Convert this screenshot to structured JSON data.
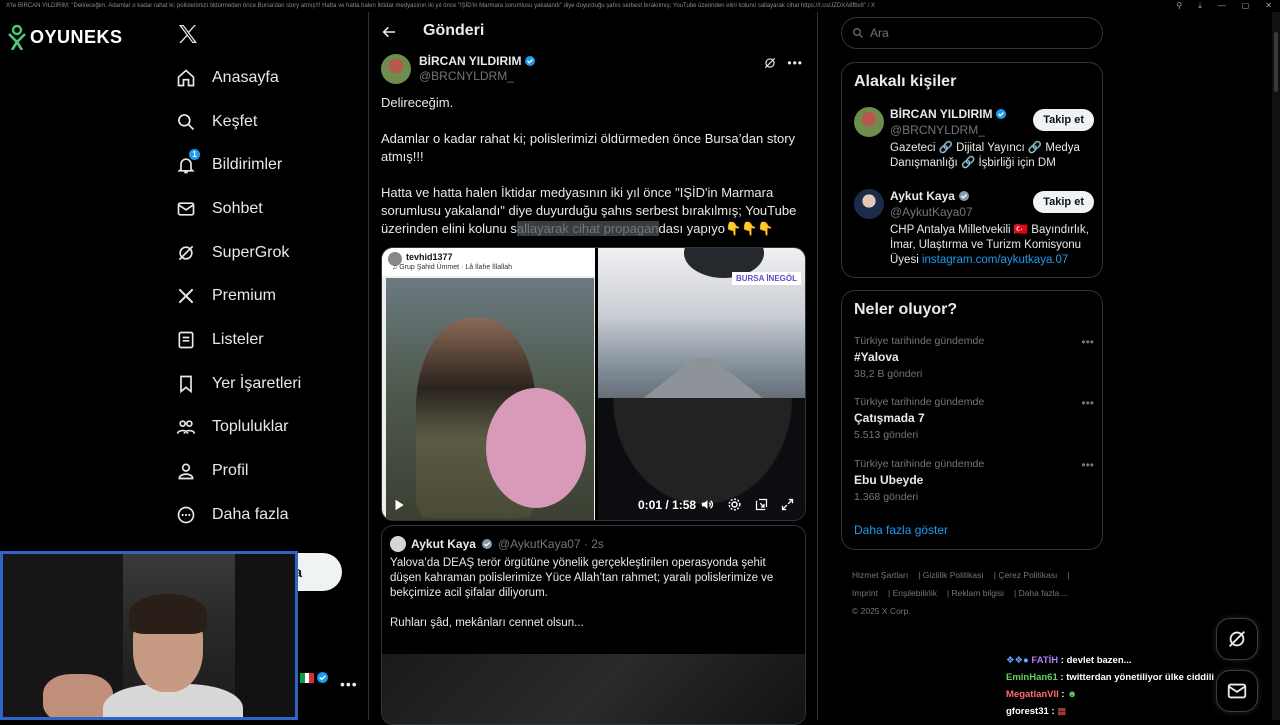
{
  "window": {
    "title": "X'te BİRCAN YILDIRIM: \"Delireceğim. Adamlar o kadar rahat ki; polislerimizi öldürmeden önce Bursa'dan story atmış!!! Hatta ve hatta halen İktidar medyasının iki yıl önce \"IŞİD'in Marmara sorumlusu yakalandı\" diye duyurduğu şahıs serbest bırakılmış; YouTube üzerinden elini kolunu sallayarak cihat https://t.co/JZDXA8fbv8\" / X"
  },
  "brand": {
    "name": "OYUNEKS"
  },
  "nav": {
    "items": [
      {
        "label": "Anasayfa",
        "icon": "home-icon"
      },
      {
        "label": "Keşfet",
        "icon": "search-icon"
      },
      {
        "label": "Bildirimler",
        "icon": "bell-icon",
        "badge": "1"
      },
      {
        "label": "Sohbet",
        "icon": "mail-icon"
      },
      {
        "label": "SuperGrok",
        "icon": "grok-icon"
      },
      {
        "label": "Premium",
        "icon": "x-icon"
      },
      {
        "label": "Listeler",
        "icon": "list-icon"
      },
      {
        "label": "Yer İşaretleri",
        "icon": "bookmark-icon"
      },
      {
        "label": "Topluluklar",
        "icon": "people-icon"
      },
      {
        "label": "Profil",
        "icon": "person-icon"
      },
      {
        "label": "Daha fazla",
        "icon": "more-circle-icon"
      }
    ],
    "post_button_partial": "a"
  },
  "post": {
    "header_title": "Gönderi",
    "author_name": "BİRCAN YILDIRIM",
    "author_handle": "@BRCNYLDRM_",
    "text_p1": "Delireceğim.",
    "text_p2": "Adamlar o kadar rahat ki; polislerimizi öldürmeden önce Bursa’dan story atmış!!!",
    "text_p3_a": "Hatta ve hatta halen İktidar medyasının iki yıl önce \"IŞİD'in Marmara sorumlusu yakalandı\" diye duyurduğu şahıs serbest bırakılmış; YouTube üzerinden elini kolunu s",
    "text_p3_hl": "allayarak cihat propagan",
    "text_p3_b": "dası yapıyo👇👇👇",
    "video": {
      "left_username": "tevhid1377",
      "left_sub": "♫ Grup Şahid Ümmet · Lâ İlahe İllallah",
      "right_tag": "BURSA İNEGÖL",
      "time": "0:01 / 1:58"
    },
    "quote": {
      "name": "Aykut Kaya",
      "handle": "@AykutKaya07 · 2s",
      "text_p1": "Yalova’da DEAŞ terör örgütüne yönelik gerçekleştirilen operasyonda şehit düşen kahraman polislerimize Yüce Allah’tan rahmet; yaralı polislerimize ve bekçimize acil şifalar diliyorum.",
      "text_p2": "Ruhları şâd, mekânları cennet olsun..."
    }
  },
  "search": {
    "placeholder": "Ara"
  },
  "related": {
    "title": "Alakalı kişiler",
    "people": [
      {
        "name": "BİRCAN YILDIRIM",
        "handle": "@BRCNYLDRM_",
        "bio": "Gazeteci 🔗 Dijital Yayıncı 🔗 Medya Danışmanlığı 🔗 İşbirliği için DM",
        "follow": "Takip et"
      },
      {
        "name": "Aykut Kaya",
        "handle": "@AykutKaya07",
        "bio": "CHP Antalya Milletvekili 🇹🇷 Bayındırlık, İmar, Ulaştırma ve Turizm Komisyonu Üyesi ",
        "link": "instagram.com/aykutkaya.07",
        "follow": "Takip et"
      }
    ]
  },
  "trends": {
    "title": "Neler oluyor?",
    "items": [
      {
        "context": "Türkiye tarihinde gündemde",
        "name": "#Yalova",
        "count": "38,2 B gönderi"
      },
      {
        "context": "Türkiye tarihinde gündemde",
        "name": "Çatışmada 7",
        "count": "5.513 gönderi"
      },
      {
        "context": "Türkiye tarihinde gündemde",
        "name": "Ebu Ubeyde",
        "count": "1.368 gönderi"
      }
    ],
    "show_more": "Daha fazla göster"
  },
  "footer": {
    "links": [
      "Hizmet Şartları",
      "Gizlilik Politikası",
      "Çerez Politikası",
      "Imprint",
      "Erişilebilirlik",
      "Reklam bilgisi",
      "Daha fazla ..."
    ],
    "copyright": "© 2025 X Corp."
  },
  "chat": [
    {
      "user": "FATİH",
      "color": "#b07cff",
      "message": "devlet bazen..."
    },
    {
      "user": "EminHan61",
      "color": "#5fd35f",
      "message": "twitterdan yönetiliyor ülke ciddili"
    },
    {
      "user": "MegatlanVII",
      "color": "#ff6b6b",
      "message": ""
    },
    {
      "user": "gforest31",
      "color": "#ffffff",
      "message": ""
    }
  ],
  "colors": {
    "accent": "#1d9bf0",
    "bg": "#000000",
    "border": "#2f3336",
    "muted": "#71767b",
    "webcam_border": "#2f64c8"
  }
}
